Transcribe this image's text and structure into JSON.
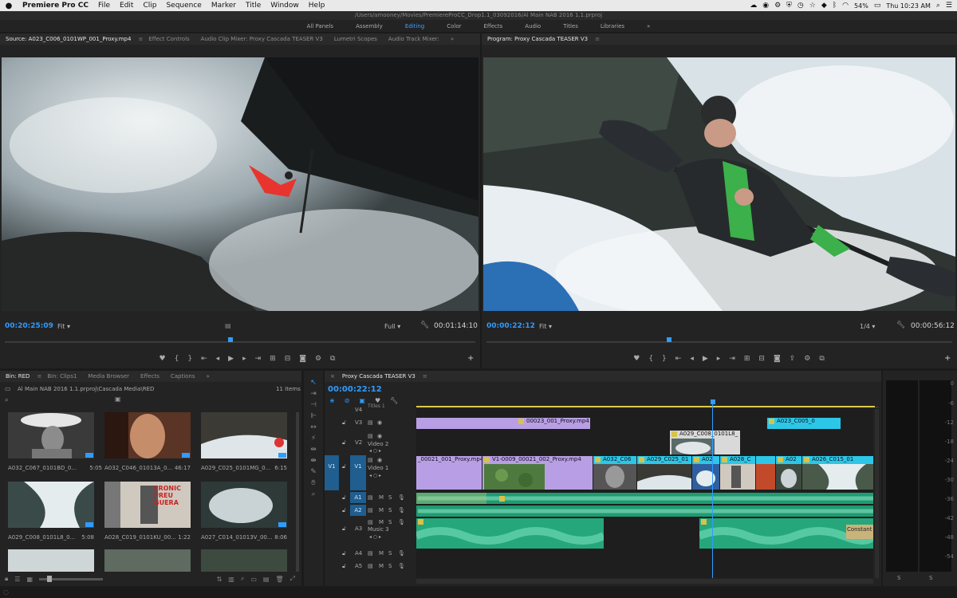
{
  "menubar": {
    "apple": "",
    "app": "Premiere Pro CC",
    "items": [
      "File",
      "Edit",
      "Clip",
      "Sequence",
      "Marker",
      "Title",
      "Window",
      "Help"
    ],
    "battery": "54%",
    "clock": "Thu 10:23 AM"
  },
  "window_title": "/Users/amooney/Movies/PremiereProCC_Drop1.1_03092016/Al Main NAB 2016 1.1.prproj",
  "workspaces": [
    "All Panels",
    "Assembly",
    "Editing",
    "Color",
    "Effects",
    "Audio",
    "Titles",
    "Libraries"
  ],
  "workspaces_more": "»",
  "source": {
    "tabs": [
      "Source: A023_C006_0101WP_001_Proxy.mp4",
      "Effect Controls",
      "Audio Clip Mixer: Proxy Cascada TEASER V3",
      "Lumetri Scopes",
      "Audio Track Mixer:"
    ],
    "more": "»",
    "timecode": "00:20:25:09",
    "fit": "Fit",
    "quality": "Full",
    "duration": "00:01:14:10"
  },
  "program": {
    "tab": "Program: Proxy Cascada TEASER V3",
    "timecode": "00:00:22:12",
    "fit": "Fit",
    "quality": "1/4",
    "duration": "00:00:56:12"
  },
  "project": {
    "tabs": [
      "Bin: RED",
      "Bin: Clips1",
      "Media Browser",
      "Effects",
      "Captions"
    ],
    "more": "»",
    "path": "Al Main NAB 2016 1.1.prproj\\Cascada Media\\RED",
    "count": "11 Items",
    "items": [
      {
        "name": "A032_C067_0101BD_0...",
        "dur": "5:05"
      },
      {
        "name": "A032_C046_01013A_0...",
        "dur": "46:17"
      },
      {
        "name": "A029_C025_0101MG_0...",
        "dur": "6:15"
      },
      {
        "name": "A029_C008_0101L8_0...",
        "dur": "5:08"
      },
      {
        "name": "A028_C019_0101KU_00...",
        "dur": "1:22"
      },
      {
        "name": "A027_C014_01013V_00...",
        "dur": "8:06"
      }
    ],
    "poster_text": "ERONIC PREU GUERA"
  },
  "timeline": {
    "tab": "Proxy Cascada TEASER V3",
    "timecode": "00:00:22:12",
    "tracks": {
      "v4": "V4",
      "v3": "V3",
      "v2": "V2",
      "v2_name": "Video 2",
      "v1_src": "V1",
      "v1": "V1",
      "v1_name": "Video 1",
      "a1": "A1",
      "a2": "A2",
      "a3": "A3",
      "a3_name": "Music 3",
      "a4": "A4",
      "a5": "A5",
      "titles": "Titles 1",
      "m": "M",
      "s": "S"
    },
    "clips": {
      "v3_a": "00023_001_Proxy.mp4",
      "v3_b": "A023_C005_0",
      "v2": "A029_C008_0101L8_",
      "v1_a": "_00021_001_Proxy.mp4",
      "v1_b": "V1-0009_00021_002_Proxy.mp4",
      "v1_c": "A032_C06",
      "v1_d": "A029_C025_01",
      "v1_e": "A02",
      "v1_f": "A028_C",
      "v1_g": "A02",
      "v1_h": "A026_C015_01",
      "a3_fx": "Constant"
    }
  },
  "meter_scale": [
    "0",
    "-6",
    "-12",
    "-18",
    "-24",
    "-30",
    "-36",
    "-42",
    "-48",
    "-54"
  ],
  "meter_solo": [
    "S",
    "S"
  ]
}
